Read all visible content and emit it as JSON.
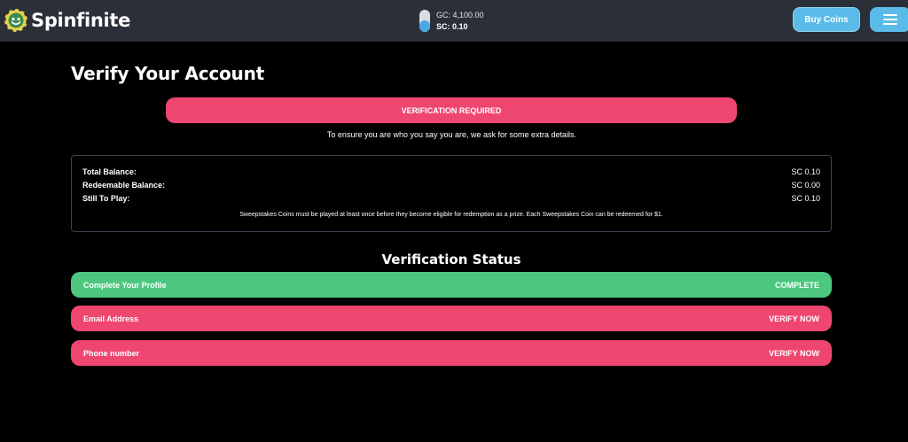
{
  "header": {
    "brand": "Spinfinite",
    "gc_balance": "GC: 4,100.00",
    "sc_balance": "SC: 0.10",
    "buy_button": "Buy Coins",
    "colors": {
      "bar": "#2b2f38",
      "accent": "#5bbbe8"
    }
  },
  "page": {
    "title": "Verify Your Account",
    "banner": "VERIFICATION REQUIRED",
    "subtitle": "To ensure you are who you say you are, we ask for some extra details."
  },
  "balances": {
    "rows": [
      {
        "label": "Total Balance:",
        "value": "SC 0.10"
      },
      {
        "label": "Redeemable Balance:",
        "value": "SC 0.00"
      },
      {
        "label": "Still To Play:",
        "value": "SC 0.10"
      }
    ],
    "note": "Sweepstakes Coins must be played at least once before they become eligible for redemption as a prize. Each Sweepstakes Coin can be redeemed for $1."
  },
  "verification": {
    "title": "Verification Status",
    "items": [
      {
        "label": "Complete Your Profile",
        "status": "COMPLETE",
        "color": "#4dc77f"
      },
      {
        "label": "Email Address",
        "status": "VERIFY NOW",
        "color": "#ef4670"
      },
      {
        "label": "Phone number",
        "status": "VERIFY NOW",
        "color": "#ef4670"
      }
    ]
  }
}
